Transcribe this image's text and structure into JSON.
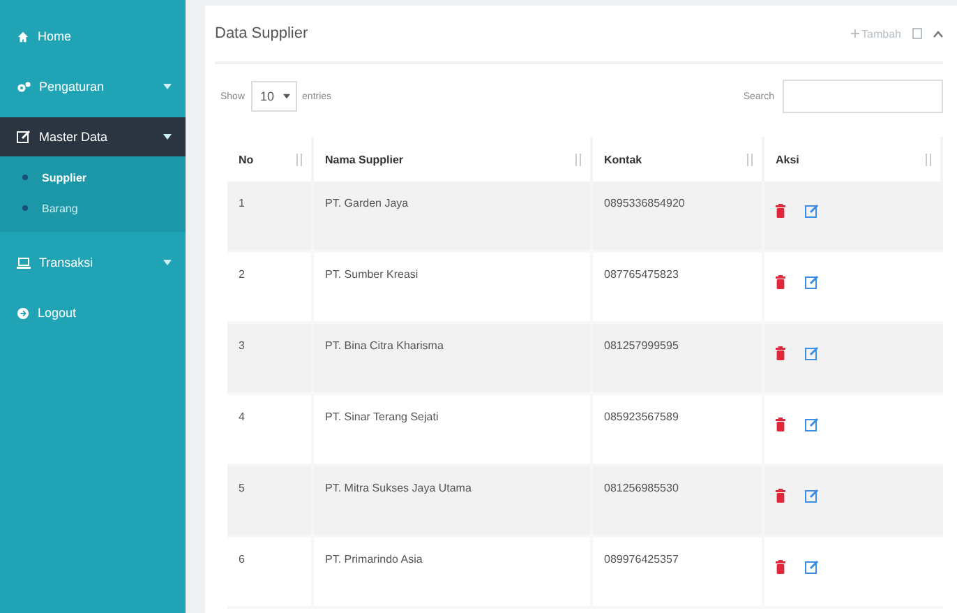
{
  "sidebar": {
    "items": [
      {
        "label": "Home",
        "kind": "link",
        "selected": false
      },
      {
        "label": "Pengaturan",
        "kind": "group",
        "selected": false
      },
      {
        "label": "Master Data",
        "kind": "group",
        "selected": true,
        "expanded": true,
        "children": [
          {
            "label": "Supplier",
            "selected": true
          },
          {
            "label": "Barang",
            "selected": false
          }
        ]
      },
      {
        "label": "Transaksi",
        "kind": "group",
        "selected": false
      },
      {
        "label": "Logout",
        "kind": "link",
        "selected": false
      }
    ]
  },
  "panel": {
    "title": "Data Supplier",
    "add_button": "Tambah"
  },
  "table_controls": {
    "show_label": "Show",
    "page_size": "10",
    "entries_label": "entries",
    "search_label": "Search"
  },
  "table": {
    "columns": [
      "No",
      "Nama Supplier",
      "Kontak",
      "Aksi"
    ],
    "rows": [
      [
        "1",
        "PT. Garden Jaya",
        "0895336854920"
      ],
      [
        "2",
        "PT. Sumber Kreasi",
        "087765475823"
      ],
      [
        "3",
        "PT. Bina Citra Kharisma",
        "081257999595"
      ],
      [
        "4",
        "PT. Sinar Terang Sejati",
        "085923567589"
      ],
      [
        "5",
        "PT. Mitra Sukses Jaya Utama",
        "081256985530"
      ],
      [
        "6",
        "PT. Primarindo Asia",
        "089976425357"
      ]
    ]
  }
}
